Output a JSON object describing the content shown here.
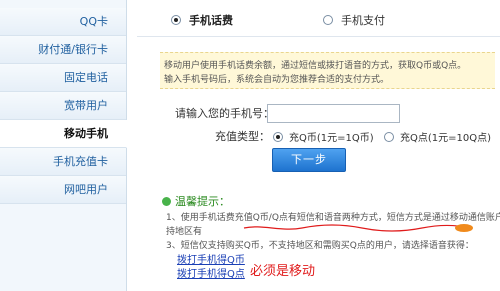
{
  "sidebar": {
    "items": [
      {
        "label": "QQ卡",
        "active": false
      },
      {
        "label": "财付通/银行卡",
        "active": false
      },
      {
        "label": "固定电话",
        "active": false
      },
      {
        "label": "宽带用户",
        "active": false
      },
      {
        "label": "移动手机",
        "active": true
      },
      {
        "label": "手机充值卡",
        "active": false
      },
      {
        "label": "网吧用户",
        "active": false
      }
    ]
  },
  "tabs": [
    {
      "label": "手机话费",
      "selected": true
    },
    {
      "label": "手机支付",
      "selected": false
    }
  ],
  "notice": {
    "line1": "移动用户使用手机话费余额，通过短信或拨打语音的方式，获取Q币或Q点。",
    "line2": "输入手机号码后，系统会自动为您推荐合适的支付方式。"
  },
  "form": {
    "phone_label": "请输入您的手机号：",
    "phone_value": "",
    "type_label": "充值类型：",
    "option_qb": "充Q币(1元=1Q币)",
    "option_qd": "充Q点(1元=10Q点)",
    "selected_option": "qb",
    "next_label": "下一步"
  },
  "tips": {
    "title": "温馨提示：",
    "line1": "1、使用手机话费充值Q币/Q点有短信和语音两种方式，短信方式是通过移动通信账户",
    "line2": "持地区有",
    "line3": "3、短信仅支持购买Q币，不支持地区和需购买Q点的用户，请选择语音获得：",
    "link1": "拨打手机得Q币",
    "link2": "拨打手机得Q点"
  },
  "annotation": {
    "text": "必须是移动",
    "color": "#e01b1b"
  },
  "colors": {
    "link": "#1a3fb5",
    "button": "#1e73cf",
    "notice_bg": "#fff8d8",
    "tip_green": "#2a8a1f"
  }
}
